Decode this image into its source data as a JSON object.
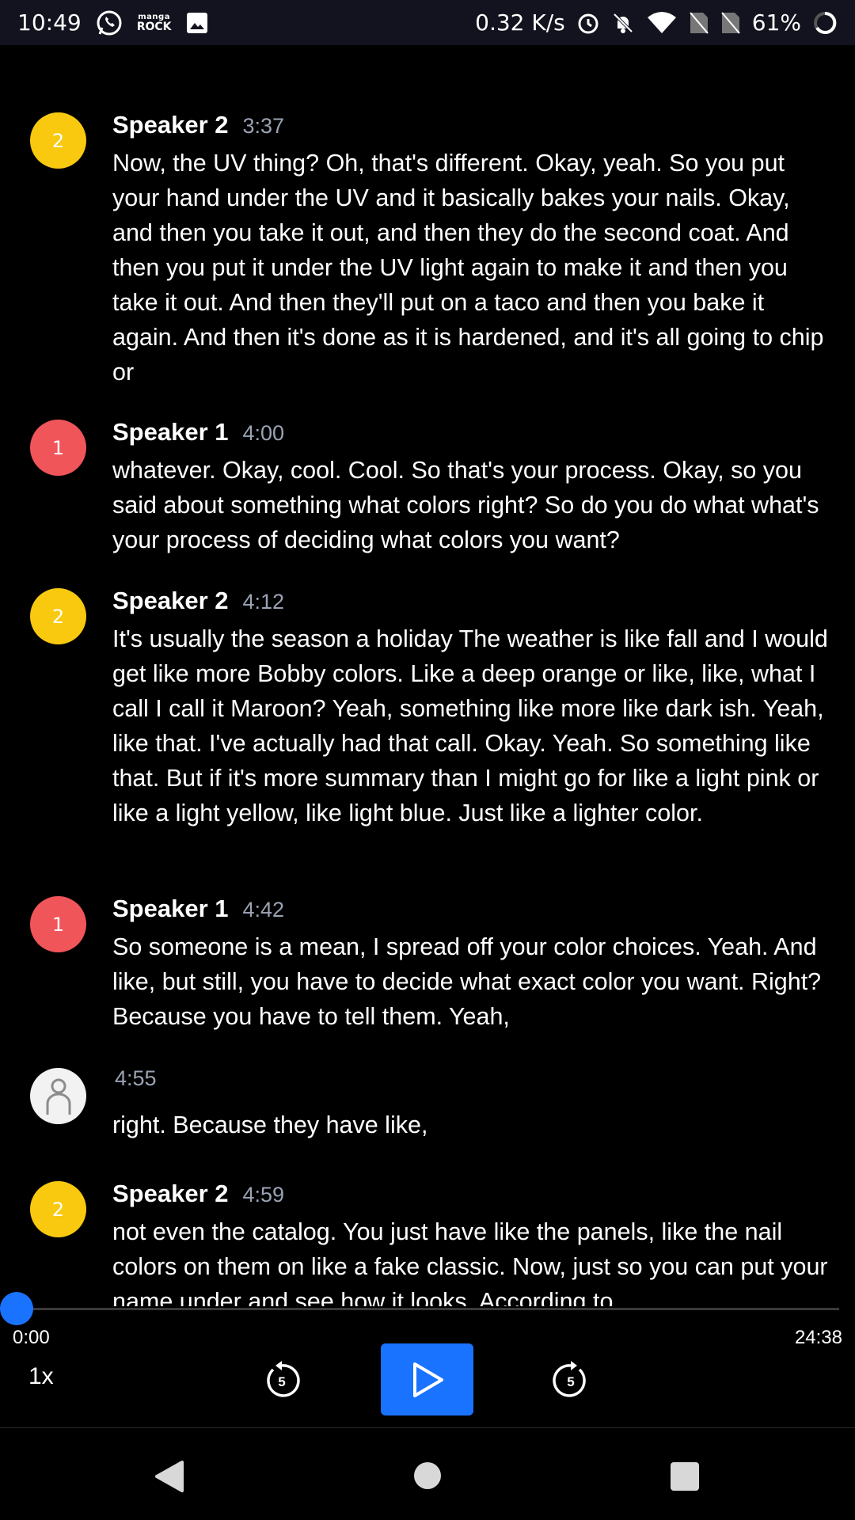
{
  "status_bar": {
    "time": "10:49",
    "manga_line1": "manga",
    "manga_line2": "ROCK",
    "net_speed": "0.32 K/s",
    "battery": "61%",
    "icons": [
      "whatsapp-icon",
      "manga-rock-icon",
      "gallery-icon",
      "alarm-icon",
      "bell-off-icon",
      "wifi-icon",
      "no-sim-icon",
      "no-sim-icon",
      "battery-ring-icon"
    ]
  },
  "colors": {
    "speaker1": "#f0555a",
    "speaker2": "#f8c90f",
    "accent": "#1a73ff",
    "timestamp": "#9aa3b3"
  },
  "transcript": [
    {
      "avatar": "2",
      "speaker": "Speaker 2",
      "time": "3:37",
      "text": "Now, the UV thing? Oh, that's different. Okay, yeah. So you put your hand under the UV and it basically bakes your nails. Okay, and then you take it out, and then they do the second coat. And then you put it under the UV light again to make it and then you take it out. And then they'll put on a taco and then you bake it again. And then it's done as it is hardened, and it's all going to chip or"
    },
    {
      "avatar": "1",
      "speaker": "Speaker 1",
      "time": "4:00",
      "text": "whatever. Okay, cool. Cool. So that's your process. Okay, so you said about something what colors right? So do you do what what's your process of deciding what colors you want?"
    },
    {
      "avatar": "2",
      "speaker": "Speaker 2",
      "time": "4:12",
      "text": "It's usually the season a holiday The weather is like fall and I would get like more Bobby colors. Like a deep orange or like, like, what I call I call it Maroon? Yeah, something like more like dark ish. Yeah, like that. I've actually had that call. Okay. Yeah. So something like that. But if it's more summary than I might go for like a light pink or like a light yellow, like light blue. Just like a lighter color."
    },
    {
      "avatar": "1",
      "speaker": "Speaker 1",
      "time": "4:42",
      "text": "So someone is a mean, I spread off your color choices. Yeah. And like, but still, you have to decide what exact color you want. Right? Because you have to tell them. Yeah,"
    },
    {
      "avatar": "",
      "speaker": "",
      "time": "4:55",
      "text": "right. Because they have like,"
    },
    {
      "avatar": "2",
      "speaker": "Speaker 2",
      "time": "4:59",
      "text": "not even the catalog. You just have like the panels, like the nail colors on them on like a fake classic. Now, just so you can put your name under and see how it looks. According to"
    }
  ],
  "player": {
    "current_time": "0:00",
    "total_time": "24:38",
    "progress": 0,
    "speed": "1x",
    "rewind_seconds": "5",
    "forward_seconds": "5",
    "icons": [
      "rewind-5-icon",
      "play-icon",
      "forward-5-icon"
    ]
  },
  "nav_bar": {
    "icons": [
      "back-icon",
      "home-icon",
      "recents-icon"
    ]
  }
}
